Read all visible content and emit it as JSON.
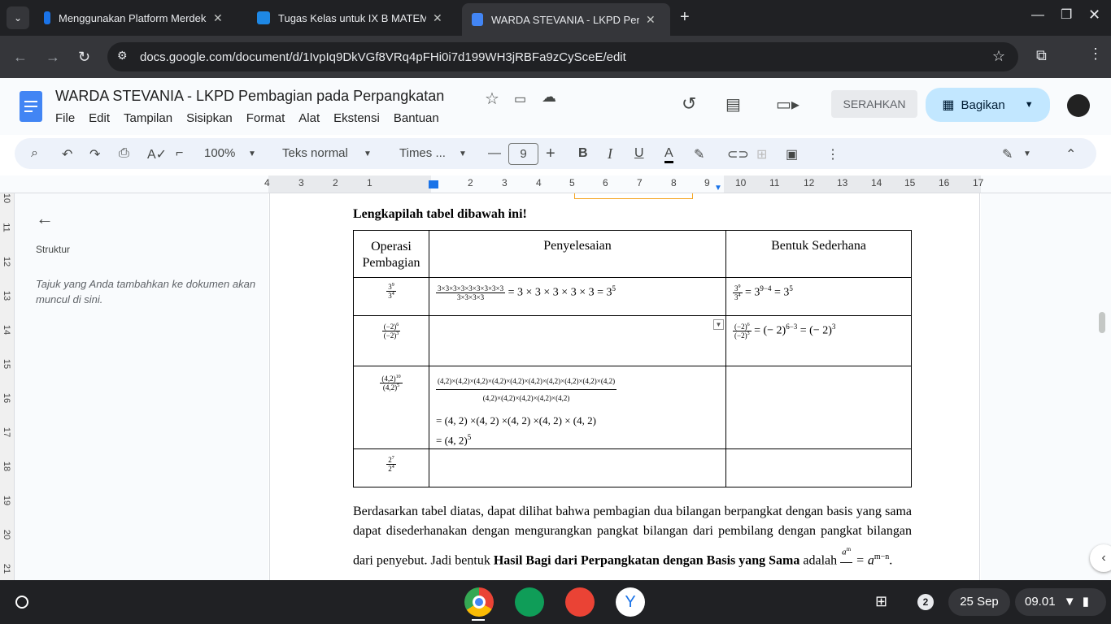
{
  "tabs": [
    {
      "title": "Menggunakan Platform Merdek"
    },
    {
      "title": "Tugas Kelas untuk IX B MATEM"
    },
    {
      "title": "WARDA STEVANIA - LKPD Pem"
    }
  ],
  "url": "docs.google.com/document/d/1IvpIq9DkVGf8VRq4pFHi0i7d199WH3jRBFa9zCySceE/edit",
  "doc": {
    "title": "WARDA STEVANIA - LKPD Pembagian pada Perpangkatan",
    "menu": [
      "File",
      "Edit",
      "Tampilan",
      "Sisipkan",
      "Format",
      "Alat",
      "Ekstensi",
      "Bantuan"
    ],
    "submit_label": "SERAHKAN",
    "share_label": "Bagikan"
  },
  "toolbar": {
    "zoom": "100%",
    "style": "Teks normal",
    "font": "Times ...",
    "size": "9"
  },
  "ruler": [
    "4",
    "3",
    "2",
    "1",
    "1",
    "2",
    "3",
    "4",
    "5",
    "6",
    "7",
    "8",
    "9",
    "10",
    "11",
    "12",
    "13",
    "14",
    "15",
    "16",
    "17"
  ],
  "vruler": [
    "10",
    "11",
    "12",
    "13",
    "14",
    "15",
    "16",
    "17",
    "18",
    "19",
    "20",
    "21"
  ],
  "outline": {
    "heading": "Struktur",
    "hint": "Tajuk yang Anda tambahkan ke dokumen akan muncul di sini."
  },
  "content": {
    "heading": "Lengkapilah tabel dibawah ini!",
    "cols": [
      "Operasi Pembagian",
      "Penyelesaian",
      "Bentuk Sederhana"
    ],
    "rows": [
      {
        "op_num": "3",
        "op_num_exp": "9",
        "op_den": "3",
        "op_den_exp": "4",
        "sol_num": "3×3×3×3×3×3×3×3×3",
        "sol_den": "3×3×3×3",
        "sol_rest": "= 3 × 3 × 3 × 3 × 3 = 3",
        "sol_rest_exp": "5",
        "simple": "= 3",
        "simple_exp": "9−4",
        "simple_end": "= 3",
        "simple_end_exp": "5"
      },
      {
        "op_num": "(−2)",
        "op_num_exp": "6",
        "op_den": "(−2)",
        "op_den_exp": "3",
        "simple": "= (− 2)",
        "simple_exp": "6−3",
        "simple_end": "= (− 2)",
        "simple_end_exp": "3"
      },
      {
        "op_num": "(4,2)",
        "op_num_exp": "10",
        "op_den": "(4,2)",
        "op_den_exp": "5",
        "sol_num": "(4,2)×(4,2)×(4,2)×(4,2)×(4,2)×(4,2)×(4,2)×(4,2)×(4,2)×(4,2)",
        "sol_den": "(4,2)×(4,2)×(4,2)×(4,2)×(4,2)",
        "line1": "= (4, 2) ×(4, 2) ×(4, 2) ×(4, 2) × (4, 2)",
        "line2": "= (4, 2)",
        "line2_exp": "5"
      },
      {
        "op_num": "2",
        "op_num_exp": "7",
        "op_den": "2",
        "op_den_exp": "4"
      }
    ],
    "para_a": "Berdasarkan tabel diatas, dapat dilihat bahwa pembagian dua bilangan berpangkat dengan basis yang sama dapat disederhanakan dengan mengurangkan pangkat bilangan dari pembilang dengan pangkat bilangan dari penyebut. Jadi bentuk ",
    "para_b": "Hasil Bagi dari Perpangkatan dengan Basis yang Sama",
    "para_c": " adalah ",
    "formula_num": "a",
    "formula_num_exp": "m",
    "formula_res": "= a",
    "formula_res_exp": "m−n",
    "formula_end": "."
  },
  "shelf": {
    "badge": "2",
    "date": "25 Sep",
    "time": "09.01"
  }
}
